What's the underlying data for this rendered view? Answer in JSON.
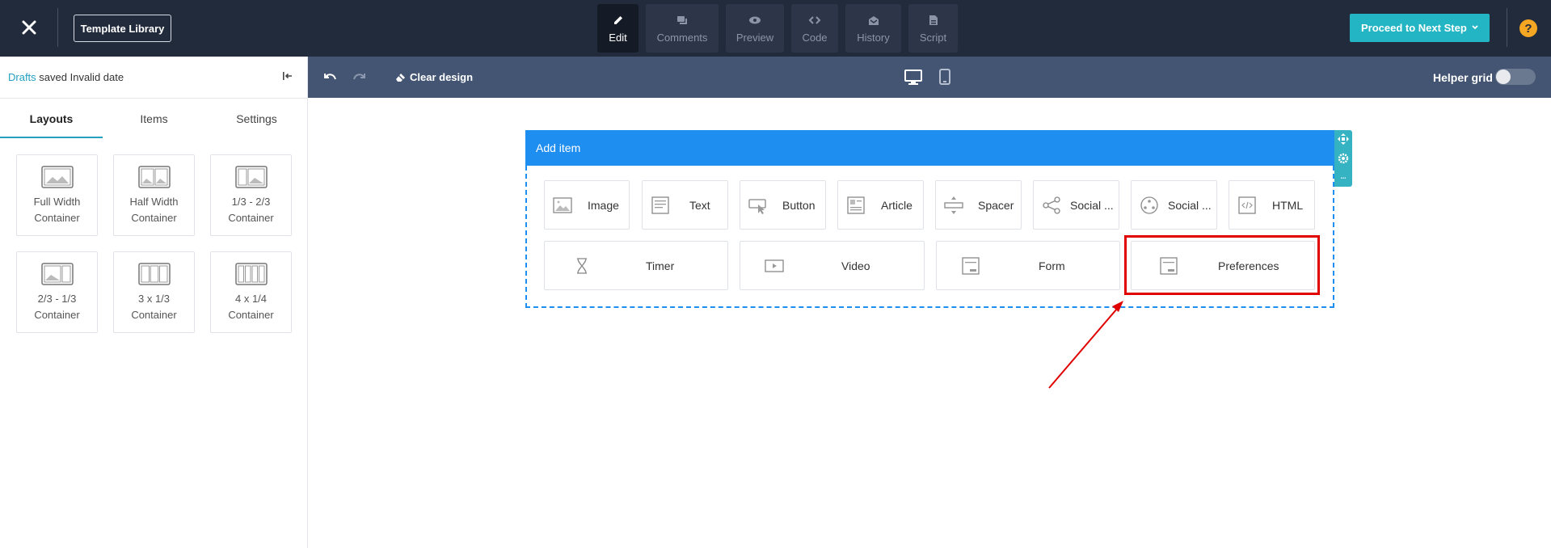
{
  "topbar": {
    "template_library": "Template Library",
    "tabs": [
      {
        "label": "Edit",
        "icon": "pencil-icon",
        "active": true
      },
      {
        "label": "Comments",
        "icon": "comments-icon",
        "active": false
      },
      {
        "label": "Preview",
        "icon": "eye-icon",
        "active": false
      },
      {
        "label": "Code",
        "icon": "code-icon",
        "active": false
      },
      {
        "label": "History",
        "icon": "history-icon",
        "active": false
      },
      {
        "label": "Script",
        "icon": "script-icon",
        "active": false
      }
    ],
    "proceed_label": "Proceed to Next Step",
    "help": "?"
  },
  "left_panel": {
    "draft_link": "Drafts",
    "draft_status": "saved Invalid date",
    "tabs": [
      {
        "label": "Layouts",
        "active": true
      },
      {
        "label": "Items",
        "active": false
      },
      {
        "label": "Settings",
        "active": false
      }
    ],
    "layouts": [
      {
        "line1": "Full Width",
        "line2": "Container"
      },
      {
        "line1": "Half Width",
        "line2": "Container"
      },
      {
        "line1": "1/3 - 2/3",
        "line2": "Container"
      },
      {
        "line1": "2/3 - 1/3",
        "line2": "Container"
      },
      {
        "line1": "3 x 1/3",
        "line2": "Container"
      },
      {
        "line1": "4 x 1/4",
        "line2": "Container"
      }
    ]
  },
  "toolbar": {
    "clear_design": "Clear design",
    "helper_grid": "Helper grid"
  },
  "editor": {
    "add_item": "Add item",
    "items_row1": [
      {
        "label": "Image",
        "icon": "image-icon"
      },
      {
        "label": "Text",
        "icon": "text-icon"
      },
      {
        "label": "Button",
        "icon": "button-icon"
      },
      {
        "label": "Article",
        "icon": "article-icon"
      },
      {
        "label": "Spacer",
        "icon": "spacer-icon"
      },
      {
        "label": "Social ...",
        "icon": "share-icon"
      },
      {
        "label": "Social ...",
        "icon": "social-follow-icon"
      },
      {
        "label": "HTML",
        "icon": "html-icon"
      }
    ],
    "items_row2": [
      {
        "label": "Timer",
        "icon": "hourglass-icon"
      },
      {
        "label": "Video",
        "icon": "video-icon"
      },
      {
        "label": "Form",
        "icon": "form-icon"
      },
      {
        "label": "Preferences",
        "icon": "preferences-icon"
      }
    ]
  },
  "colors": {
    "topbar": "#222b3c",
    "toolbar": "#435572",
    "accent": "#23b5c3",
    "add_item": "#1f8ef1",
    "highlight": "#e00000"
  }
}
